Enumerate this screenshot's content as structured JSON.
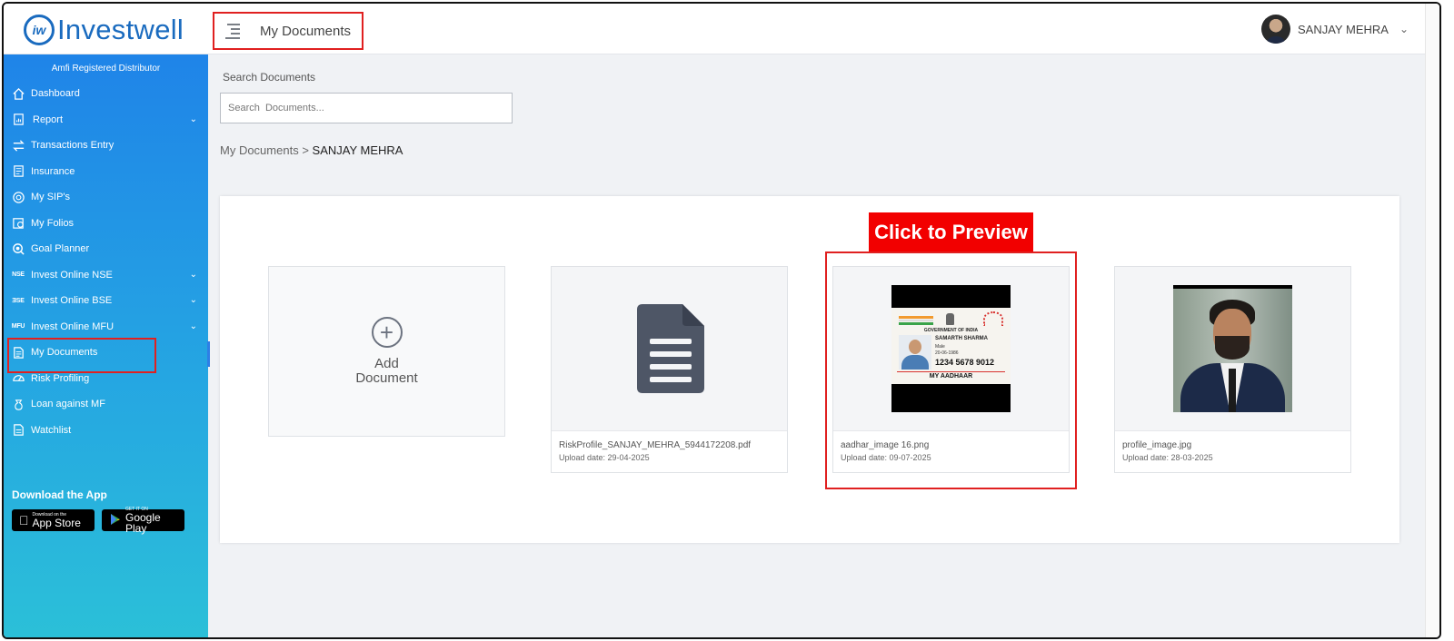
{
  "header": {
    "logo_mark": "iw",
    "logo_text": "Investwell",
    "title": "My Documents",
    "user_name": "SANJAY MEHRA",
    "chevron": "⌄"
  },
  "sidebar": {
    "amfi": "Amfi Registered Distributor",
    "items": [
      {
        "label": "Dashboard",
        "icon": "home-icon",
        "arrow": ""
      },
      {
        "label": "Report",
        "icon": "report-icon",
        "arrow": "⌄"
      },
      {
        "label": "Transactions Entry",
        "icon": "transfer-icon",
        "arrow": ""
      },
      {
        "label": "Insurance",
        "icon": "insurance-icon",
        "arrow": ""
      },
      {
        "label": "My SIP's",
        "icon": "sip-icon",
        "arrow": ""
      },
      {
        "label": "My Folios",
        "icon": "folio-icon",
        "arrow": ""
      },
      {
        "label": "Goal Planner",
        "icon": "goal-icon",
        "arrow": ""
      },
      {
        "label": "Invest Online NSE",
        "icon": "nse-icon",
        "icon_text": "NSE",
        "arrow": "⌄"
      },
      {
        "label": "Invest Online BSE",
        "icon": "bse-icon",
        "icon_text": "ƎSE",
        "arrow": "⌄"
      },
      {
        "label": "Invest Online MFU",
        "icon": "mfu-icon",
        "icon_text": "MFU",
        "arrow": "⌄"
      },
      {
        "label": "My Documents",
        "icon": "document-icon",
        "arrow": ""
      },
      {
        "label": "Risk Profiling",
        "icon": "gauge-icon",
        "arrow": ""
      },
      {
        "label": "Loan against MF",
        "icon": "loan-icon",
        "arrow": ""
      },
      {
        "label": "Watchlist",
        "icon": "watchlist-icon",
        "arrow": ""
      }
    ],
    "download_title": "Download the App",
    "app_store": {
      "small": "Download on the",
      "big": "App Store"
    },
    "google_play": {
      "small": "GET IT ON",
      "big": "Google Play"
    }
  },
  "main": {
    "search_label": "Search Documents",
    "search_placeholder": "Search  Documents...",
    "search_value": "",
    "breadcrumb_root": "My Documents",
    "breadcrumb_sep": " > ",
    "breadcrumb_current": "SANJAY MEHRA",
    "add_symbol": "+",
    "add_label_1": "Add",
    "add_label_2": "Document",
    "preview_tag": "Click to Preview",
    "documents": [
      {
        "name": "RiskProfile_SANJAY_MEHRA_5944172208.pdf",
        "date": "Upload date: 29-04-2025"
      },
      {
        "name": "aadhar_image 16.png",
        "date": "Upload date: 09-07-2025"
      },
      {
        "name": "profile_image.jpg",
        "date": "Upload date: 28-03-2025"
      }
    ],
    "aadhaar": {
      "gov": "GOVERNMENT OF INDIA",
      "name": "SAMARTH SHARMA",
      "gender": "Male",
      "dob": "20-06-1986",
      "number": "1234 5678 9012",
      "footer": "MY AADHAAR",
      "sun_text": "आधार"
    }
  },
  "colors": {
    "brand": "#1a6bbf",
    "highlight": "#e02020",
    "sidebar_top": "#1f84e8",
    "sidebar_bottom": "#2bc0d8"
  }
}
